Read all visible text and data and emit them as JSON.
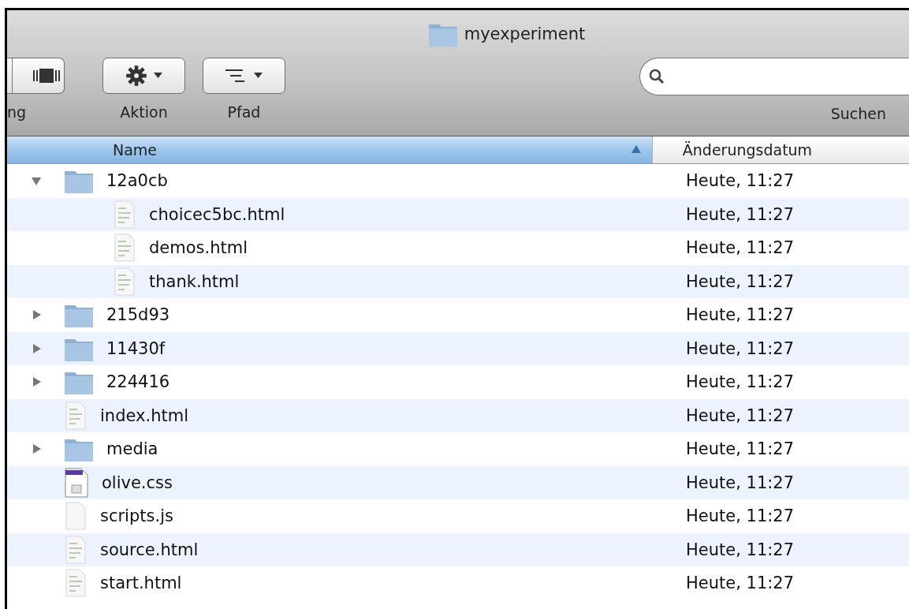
{
  "window": {
    "title": "myexperiment"
  },
  "toolbar": {
    "items": [
      {
        "kind": "view",
        "label": "ng"
      },
      {
        "kind": "action",
        "label": "Aktion"
      },
      {
        "kind": "path",
        "label": "Pfad"
      }
    ],
    "search": {
      "label": "Suchen"
    }
  },
  "table": {
    "columns": [
      {
        "label": "Name",
        "selected": true,
        "sorted": true,
        "ascending": true
      },
      {
        "label": "Änderungsdatum",
        "selected": false
      }
    ],
    "rows": [
      {
        "kind": "folder",
        "name": "12a0cb",
        "date": "Heute, 11:27",
        "expanded": true,
        "children": [
          {
            "kind": "html",
            "name": "choicec5bc.html",
            "date": "Heute, 11:27"
          },
          {
            "kind": "html",
            "name": "demos.html",
            "date": "Heute, 11:27"
          },
          {
            "kind": "html",
            "name": "thank.html",
            "date": "Heute, 11:27"
          }
        ]
      },
      {
        "kind": "folder",
        "name": "215d93",
        "date": "Heute, 11:27",
        "expanded": false
      },
      {
        "kind": "folder",
        "name": "11430f",
        "date": "Heute, 11:27",
        "expanded": false
      },
      {
        "kind": "folder",
        "name": "224416",
        "date": "Heute, 11:27",
        "expanded": false
      },
      {
        "kind": "html",
        "name": "index.html",
        "date": "Heute, 11:27"
      },
      {
        "kind": "folder",
        "name": "media",
        "date": "Heute, 11:27",
        "expanded": false
      },
      {
        "kind": "css",
        "name": "olive.css",
        "date": "Heute, 11:27"
      },
      {
        "kind": "js",
        "name": "scripts.js",
        "date": "Heute, 11:27"
      },
      {
        "kind": "html",
        "name": "source.html",
        "date": "Heute, 11:27"
      },
      {
        "kind": "html",
        "name": "start.html",
        "date": "Heute, 11:27"
      }
    ]
  }
}
